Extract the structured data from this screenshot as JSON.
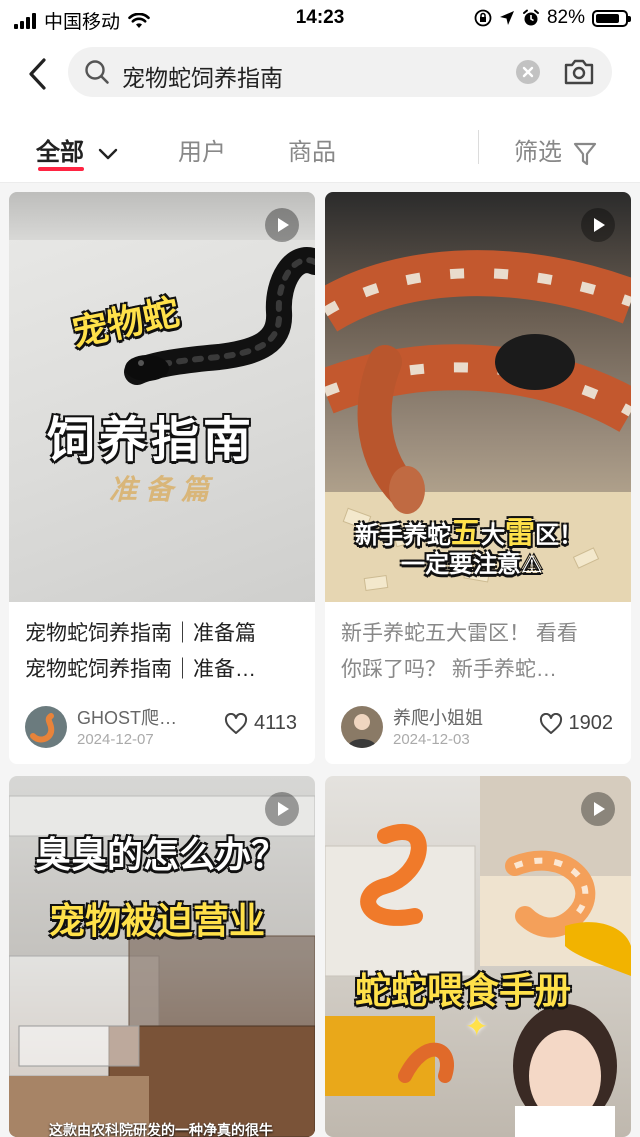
{
  "status_bar": {
    "carrier": "中国移动",
    "time": "14:23",
    "battery": "82%",
    "battery_level": 0.82
  },
  "header": {
    "search_query": "宠物蛇饲养指南"
  },
  "tabs": {
    "all": "全部",
    "users": "用户",
    "goods": "商品",
    "filter": "筛选"
  },
  "cards": [
    {
      "poster": {
        "line1": "宠物蛇",
        "line2": "饲养指南",
        "line3": "准备篇"
      },
      "title_line1": "宠物蛇饲养指南｜准备篇",
      "title_line2": "宠物蛇饲养指南｜准备…",
      "author": "GHOST爬…",
      "date": "2024-12-07",
      "likes": "4113"
    },
    {
      "poster": {
        "line1a": "新手养蛇",
        "line1b": "五",
        "line1c": "大",
        "line1d": "雷",
        "line1e": "区！",
        "line2": "一定要注意⚠"
      },
      "title_line1": "新手养蛇五大雷区！ 看看",
      "title_line2": "你踩了吗？ 新手养蛇…",
      "author": "养爬小姐姐",
      "date": "2024-12-03",
      "likes": "1902"
    },
    {
      "poster": {
        "line1": "臭臭的怎么办？",
        "line2": "宠物被迫营业",
        "caption": "这款由农科院研发的一种净真的很牛"
      }
    },
    {
      "poster": {
        "line1": "蛇蛇喂食手册",
        "sparkle": "✦"
      }
    }
  ],
  "colors": {
    "accent": "#ff2442",
    "background": "#f5f5f5",
    "highlight_yellow": "#ffe14a"
  }
}
